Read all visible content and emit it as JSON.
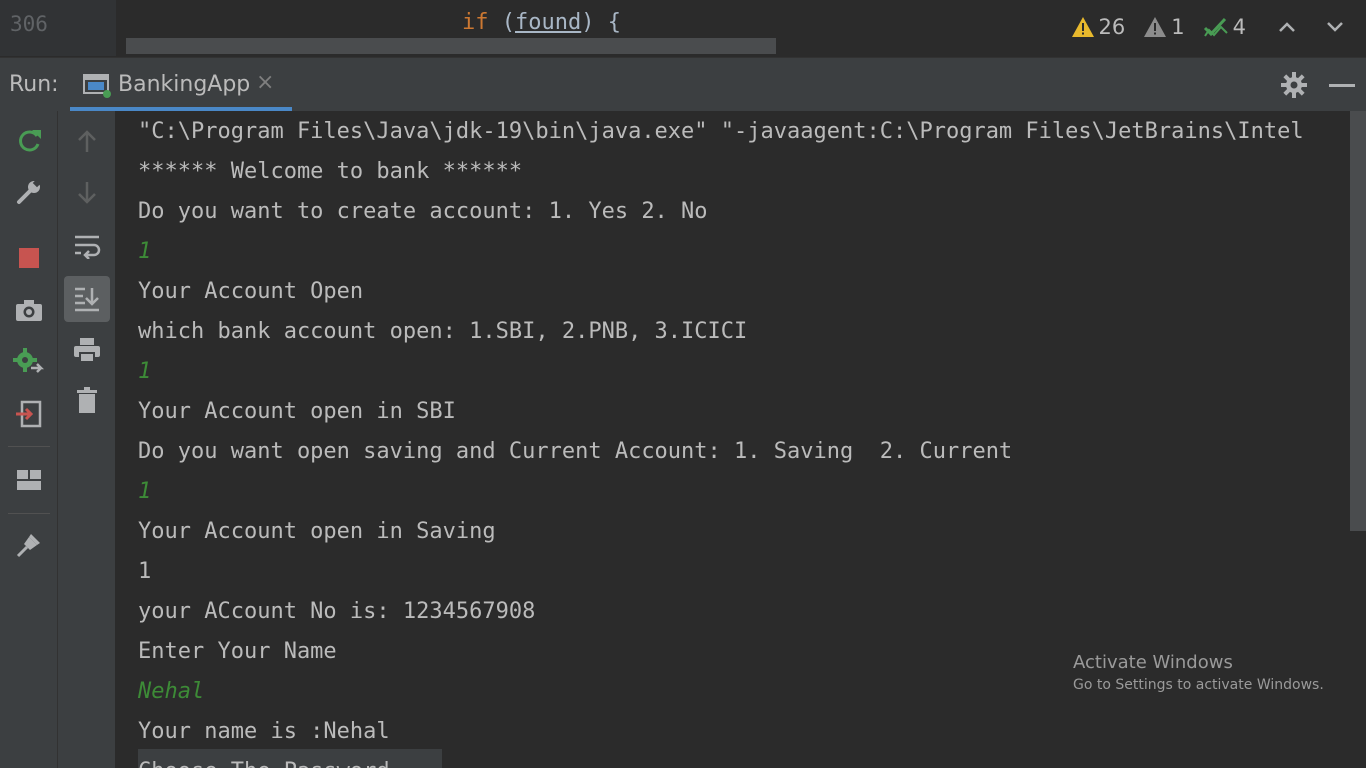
{
  "editor": {
    "line_number": "306",
    "code_keyword": "if",
    "code_open": " (",
    "code_var": "found",
    "code_close": ") {"
  },
  "inspections": {
    "warnings": "26",
    "weak_warnings": "1",
    "ok": "4"
  },
  "run_panel": {
    "label": "Run:",
    "tab_label": "BankingApp",
    "tab_close": "×"
  },
  "console": {
    "lines": [
      {
        "text": "\"C:\\Program Files\\Java\\jdk-19\\bin\\java.exe\" \"-javaagent:C:\\Program Files\\JetBrains\\Intel",
        "kind": "output"
      },
      {
        "text": "****** Welcome to bank ******",
        "kind": "output"
      },
      {
        "text": "Do you want to create account: 1. Yes 2. No",
        "kind": "output"
      },
      {
        "text": "1",
        "kind": "input"
      },
      {
        "text": "Your Account Open",
        "kind": "output"
      },
      {
        "text": "which bank account open: 1.SBI, 2.PNB, 3.ICICI",
        "kind": "output"
      },
      {
        "text": "1",
        "kind": "input"
      },
      {
        "text": "Your Account open in SBI",
        "kind": "output"
      },
      {
        "text": "Do you want open saving and Current Account: 1. Saving  2. Current",
        "kind": "output"
      },
      {
        "text": "1",
        "kind": "input"
      },
      {
        "text": "Your Account open in Saving",
        "kind": "output"
      },
      {
        "text": "1",
        "kind": "output"
      },
      {
        "text": "your ACcount No is: 1234567908",
        "kind": "output"
      },
      {
        "text": "Enter Your Name",
        "kind": "output"
      },
      {
        "text": "Nehal",
        "kind": "input"
      },
      {
        "text": "Your name is :Nehal",
        "kind": "output"
      },
      {
        "text": "Choose The Password",
        "kind": "output"
      }
    ]
  },
  "watermark": {
    "title": "Activate Windows",
    "subtitle": "Go to Settings to activate Windows."
  },
  "colors": {
    "background": "#2b2b2b",
    "panel": "#3c3f41",
    "input_text": "#3d8b37",
    "tab_underline": "#4a88c7",
    "rerun_green": "#499c54",
    "stop_red": "#c75450",
    "warning_yellow": "#e8b92d"
  },
  "icons": {
    "main_toolbar": [
      "rerun-icon",
      "modify-run-config-icon",
      "stop-icon",
      "dump-threads-icon",
      "exit-services-icon",
      "exit-icon",
      "restore-layout-icon",
      "pin-tab-icon"
    ],
    "console_toolbar": [
      "up-stack-icon",
      "down-stack-icon",
      "soft-wrap-icon",
      "scroll-to-end-icon",
      "print-icon",
      "clear-all-icon"
    ]
  }
}
